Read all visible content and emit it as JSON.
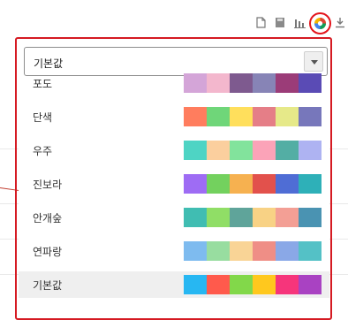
{
  "toolbar": {
    "icons": [
      "export-icon",
      "save-icon",
      "chart-icon",
      "palette-icon",
      "download-icon"
    ]
  },
  "select": {
    "value": "기본값"
  },
  "palettes": [
    {
      "label": "포도",
      "colors": [
        "#d4a5d8",
        "#f3b7cd",
        "#7e5a8f",
        "#8784b6",
        "#9b3c78",
        "#5a4bb5"
      ]
    },
    {
      "label": "단색",
      "colors": [
        "#ff7d5e",
        "#6fd679",
        "#ffdf5c",
        "#e57e87",
        "#e6e989",
        "#7777bb"
      ]
    },
    {
      "label": "우주",
      "colors": [
        "#4ed4c4",
        "#fbcf9e",
        "#82e39c",
        "#fba3b8",
        "#53aea4",
        "#aeb3f2"
      ]
    },
    {
      "label": "진보라",
      "colors": [
        "#9e6cf4",
        "#73d15e",
        "#f6b150",
        "#e2514c",
        "#4f6dd5",
        "#2eb0b8"
      ]
    },
    {
      "label": "안개숲",
      "colors": [
        "#40bdb2",
        "#90de66",
        "#5fa49a",
        "#f8d285",
        "#f39f95",
        "#4a93b2"
      ]
    },
    {
      "label": "연파랑",
      "colors": [
        "#7ebbef",
        "#98dda0",
        "#f9d496",
        "#ef8e86",
        "#8aa8e7",
        "#54c1c6"
      ]
    },
    {
      "label": "기본값",
      "colors": [
        "#27b7f2",
        "#ff5a4c",
        "#82d84a",
        "#ffc81e",
        "#f6357b",
        "#a942c2"
      ],
      "selected": true
    }
  ]
}
